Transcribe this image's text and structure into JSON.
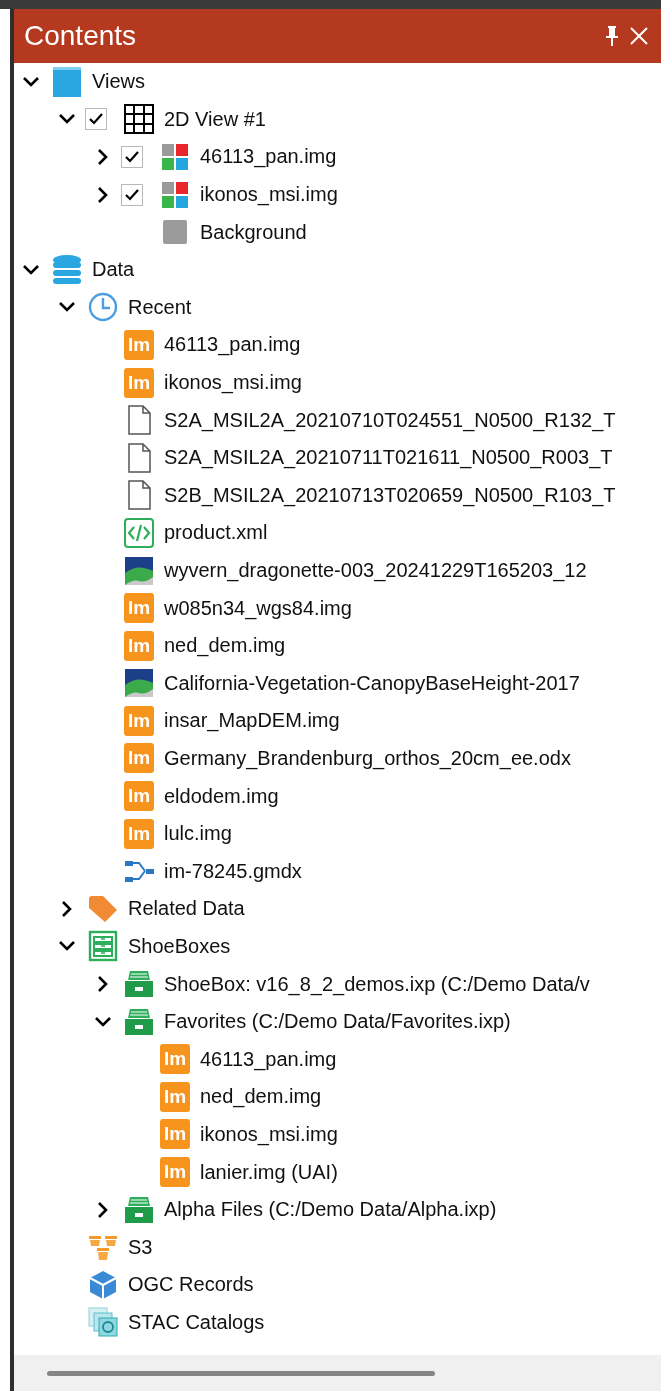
{
  "panel": {
    "title": "Contents"
  },
  "tree": [
    {
      "label": "Views",
      "kind": "window",
      "expanded": true,
      "children": [
        {
          "label": "2D View #1",
          "kind": "grid",
          "expanded": true,
          "checked": true,
          "children": [
            {
              "label": "46113_pan.img",
              "kind": "raster",
              "expanded": false,
              "checked": true
            },
            {
              "label": "ikonos_msi.img",
              "kind": "raster",
              "expanded": false,
              "checked": true
            },
            {
              "label": "Background",
              "kind": "swatch"
            }
          ]
        }
      ]
    },
    {
      "label": "Data",
      "kind": "database",
      "expanded": true,
      "children": [
        {
          "label": "Recent",
          "kind": "clock",
          "expanded": true,
          "children": [
            {
              "label": "46113_pan.img",
              "kind": "image",
              "badge": "Im"
            },
            {
              "label": "ikonos_msi.img",
              "kind": "image",
              "badge": "Im"
            },
            {
              "label": "S2A_MSIL2A_20210710T024551_N0500_R132_T",
              "kind": "file"
            },
            {
              "label": "S2A_MSIL2A_20210711T021611_N0500_R003_T",
              "kind": "file"
            },
            {
              "label": "S2B_MSIL2A_20210713T020659_N0500_R103_T",
              "kind": "file"
            },
            {
              "label": "product.xml",
              "kind": "xml"
            },
            {
              "label": "wyvern_dragonette-003_20241229T165203_12",
              "kind": "scene"
            },
            {
              "label": "w085n34_wgs84.img",
              "kind": "image",
              "badge": "Im"
            },
            {
              "label": "ned_dem.img",
              "kind": "image",
              "badge": "Im"
            },
            {
              "label": "California-Vegetation-CanopyBaseHeight-2017",
              "kind": "scene"
            },
            {
              "label": "insar_MapDEM.img",
              "kind": "image",
              "badge": "Im"
            },
            {
              "label": "Germany_Brandenburg_orthos_20cm_ee.odx",
              "kind": "image",
              "badge": "Im"
            },
            {
              "label": "eldodem.img",
              "kind": "image",
              "badge": "Im"
            },
            {
              "label": "lulc.img",
              "kind": "image",
              "badge": "Im"
            },
            {
              "label": "im-78245.gmdx",
              "kind": "model"
            }
          ]
        },
        {
          "label": "Related Data",
          "kind": "tag",
          "expanded": false
        },
        {
          "label": "ShoeBoxes",
          "kind": "cabinet",
          "expanded": true,
          "children": [
            {
              "label": "ShoeBox: v16_8_2_demos.ixp (C:/Demo Data/v",
              "kind": "drawer",
              "expanded": false
            },
            {
              "label": "Favorites (C:/Demo Data/Favorites.ixp)",
              "kind": "drawer",
              "expanded": true,
              "children": [
                {
                  "label": "46113_pan.img",
                  "kind": "image",
                  "badge": "Im"
                },
                {
                  "label": "ned_dem.img",
                  "kind": "image",
                  "badge": "Im"
                },
                {
                  "label": "ikonos_msi.img",
                  "kind": "image",
                  "badge": "Im"
                },
                {
                  "label": "lanier.img (UAI)",
                  "kind": "image",
                  "badge": "Im"
                }
              ]
            },
            {
              "label": "Alpha Files (C:/Demo Data/Alpha.ixp)",
              "kind": "drawer",
              "expanded": false
            }
          ]
        },
        {
          "label": "S3",
          "kind": "buckets"
        },
        {
          "label": "OGC Records",
          "kind": "cube"
        },
        {
          "label": "STAC Catalogs",
          "kind": "stack"
        }
      ]
    }
  ]
}
